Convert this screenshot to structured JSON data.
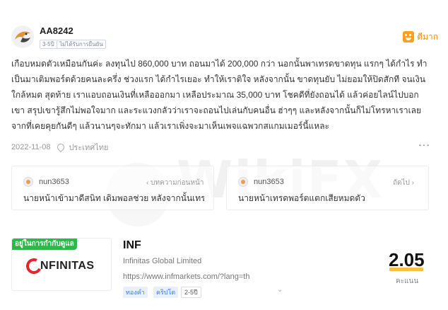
{
  "watermark": {
    "text": "WikiFX"
  },
  "post": {
    "username": "AA8242",
    "badge_years": "3-5ปี",
    "badge_unverified": "ไม่ได้รับการยืนยัน",
    "rating_label": "ดีมาก",
    "body": "เกือบหมดตัวเหมือนกันค่ะ ลงทุนไป 860,000 บาท ถอนมาได้ 200,000 กว่า นอกนั้นพาเทรดขาดทุน แรกๆ ได้กำไร ทำเป็นมาเติมพอร์ตด้วยคนละครึ่ง ช่วงแรก ได้กำไรเยอะ ทำให้เราติใจ หลังจากนั้น ขาดทุนยับ ไม่ยอมให้ปิดสักที จนเงินใกล้หมด สุดท้าย เราแอบถอนเงินที่เหลือออกมา เหลือประมาณ 35,000 บาท โชคดีที่ยังถอนได้ แล้วค่อยไลน์ไปบอกเขา สรุปเขารู้สึกไม่พอใจมาก และระแวงกลัวว่าเราจะถอนไปเล่นกับคนอื่น ฮ่าๆๆ และหลังจากนั้นก็ไม่โทรหาเราเลยจากที่เคยคุยกันดีๆ แล้วนานๆจะทักมา แล้วเราเพิ่งจะมาเห็นเพจแฉพวกสแกมเมอร์นี้แหละ",
    "date": "2022-11-08",
    "location": "ประเทศไทย",
    "more_label": "···",
    "icons": {
      "avatar": "eagle-avatar-icon",
      "rating": "smiley-face-icon",
      "location": "location-pin-icon",
      "more": "more-dots-icon"
    }
  },
  "nav": {
    "prev": {
      "nick": "nun3653",
      "direction": "บทความก่อนหน้า",
      "title": "นายหน้าเข้ามาดีสนิท เดิมพอลช่วย หลังจากนั้นเทรดแ..."
    },
    "next": {
      "nick": "nun3653",
      "direction": "ถัดไป",
      "title": "นายหน้าเทรดพอร์ตแตกเสียหมดตัว"
    }
  },
  "broker": {
    "regulated_tag": "อยู่ในการกำกับดูแล",
    "logo_text": "NFINITAS",
    "name": "INF",
    "full_name": "Infinitas Global Limited",
    "url": "https://www.infmarkets.com/?lang=th",
    "tags": [
      "ทองคำ",
      "คริปโต",
      "2-5ปี"
    ],
    "score": "2.05",
    "score_label": "คะแนน",
    "colors": {
      "regulated": "#2db84b",
      "score_bar": "#f5c242",
      "logo_red": "#e1272d"
    }
  }
}
